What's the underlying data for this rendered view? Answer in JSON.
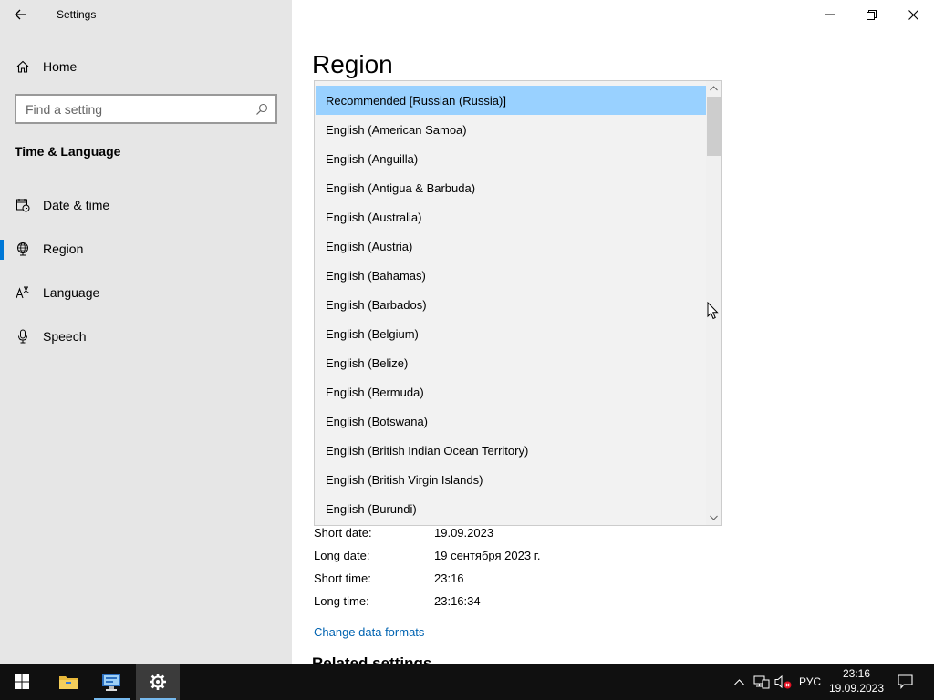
{
  "window": {
    "title": "Settings"
  },
  "nav": {
    "home_label": "Home",
    "search_placeholder": "Find a setting",
    "section_title": "Time & Language",
    "items": [
      {
        "label": "Date & time",
        "icon": "calendar-clock-icon",
        "selected": false
      },
      {
        "label": "Region",
        "icon": "globe-icon",
        "selected": true
      },
      {
        "label": "Language",
        "icon": "language-icon",
        "selected": false
      },
      {
        "label": "Speech",
        "icon": "microphone-icon",
        "selected": false
      }
    ]
  },
  "main": {
    "page_title": "Region",
    "dropdown": {
      "items": [
        "Recommended [Russian (Russia)]",
        "English (American Samoa)",
        "English (Anguilla)",
        "English (Antigua & Barbuda)",
        "English (Australia)",
        "English (Austria)",
        "English (Bahamas)",
        "English (Barbados)",
        "English (Belgium)",
        "English (Belize)",
        "English (Bermuda)",
        "English (Botswana)",
        "English (British Indian Ocean Territory)",
        "English (British Virgin Islands)",
        "English (Burundi)"
      ],
      "selected_index": 0
    },
    "formats": [
      {
        "label": "Short date:",
        "value": "19.09.2023"
      },
      {
        "label": "Long date:",
        "value": "19 сентября 2023 г."
      },
      {
        "label": "Short time:",
        "value": "23:16"
      },
      {
        "label": "Long time:",
        "value": "23:16:34"
      }
    ],
    "change_formats_link": "Change data formats",
    "related_settings_heading": "Related settings"
  },
  "taskbar": {
    "language_indicator": "РУС",
    "time": "23:16",
    "date": "19.09.2023"
  },
  "colors": {
    "accent": "#0078d7",
    "selection": "#99d1ff",
    "link": "#0063b1"
  }
}
